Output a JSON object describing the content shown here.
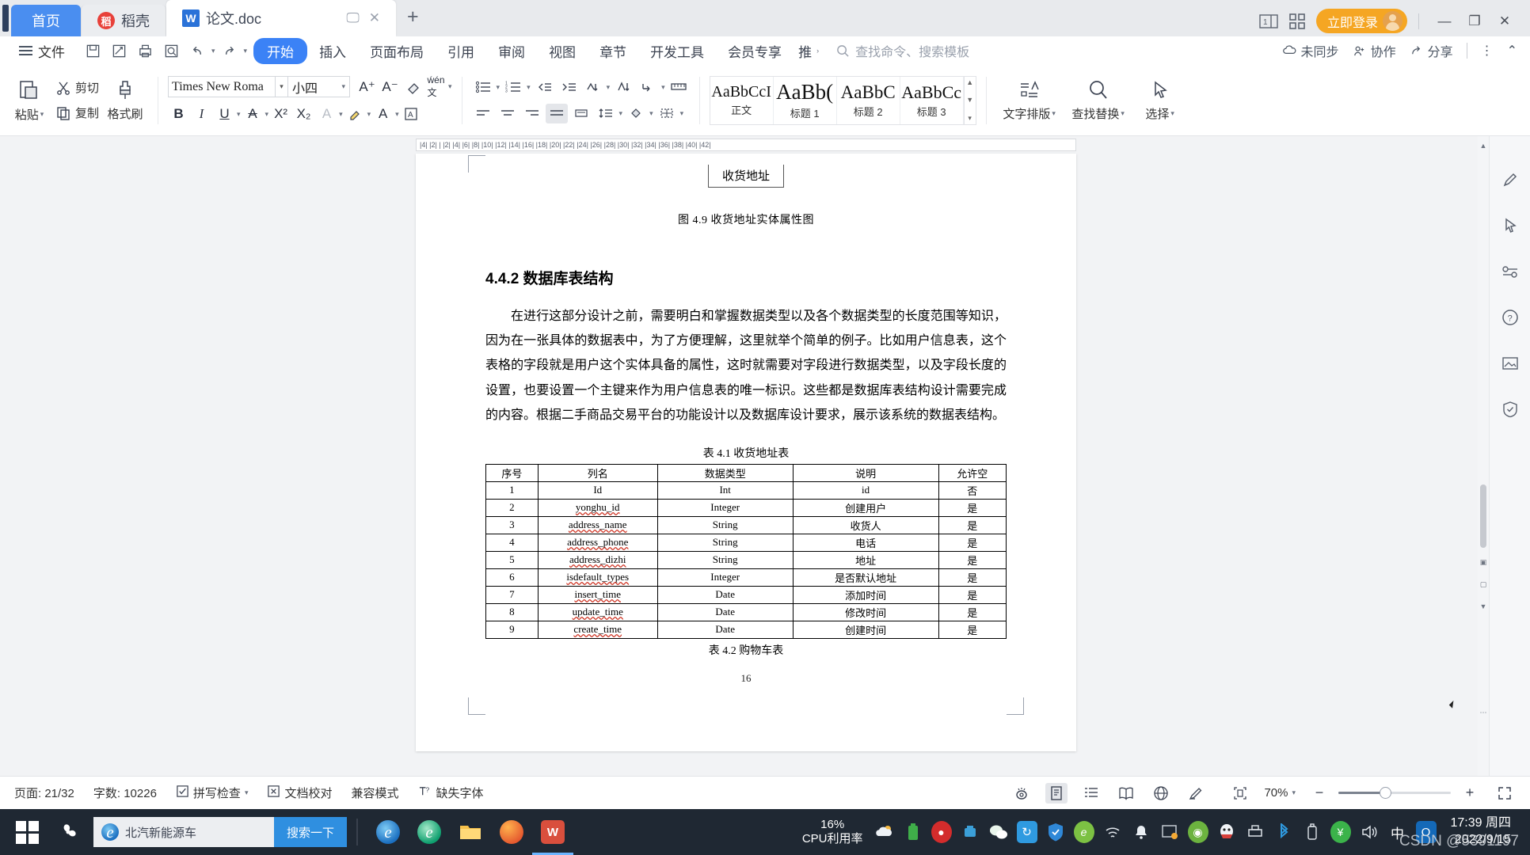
{
  "window": {
    "tabs": [
      {
        "label": "首页",
        "icon": "home-icon",
        "state": "home"
      },
      {
        "label": "稻壳",
        "icon": "docer-icon",
        "state": "inactive"
      },
      {
        "label": "论文.doc",
        "icon": "wps-writer-icon",
        "state": "active"
      }
    ],
    "tab_actions": {
      "cast_icon": "cast-icon",
      "close_icon": "close-icon",
      "new_tab": "+"
    },
    "right_icons": {
      "sidebar_icon": "page-toggle-icon",
      "apps_icon": "app-grid-icon"
    },
    "login_label": "立即登录",
    "controls": {
      "minimize": "—",
      "maximize": "❐",
      "close": "✕"
    }
  },
  "menubar": {
    "file_label": "文件",
    "quick_access": [
      "save-icon",
      "save-as-icon",
      "print-icon",
      "print-preview-icon",
      "undo-icon",
      "redo-icon",
      "qat-more-icon"
    ],
    "tabs": [
      {
        "label": "开始",
        "active": true
      },
      {
        "label": "插入",
        "active": false
      },
      {
        "label": "页面布局",
        "active": false
      },
      {
        "label": "引用",
        "active": false
      },
      {
        "label": "审阅",
        "active": false
      },
      {
        "label": "视图",
        "active": false
      },
      {
        "label": "章节",
        "active": false
      },
      {
        "label": "开发工具",
        "active": false
      },
      {
        "label": "会员专享",
        "active": false
      },
      {
        "label": "推",
        "active": false
      }
    ],
    "search_placeholder": "查找命令、搜索模板",
    "right": [
      {
        "label": "未同步",
        "icon": "cloud-sync-icon"
      },
      {
        "label": "协作",
        "icon": "collaborate-icon"
      },
      {
        "label": "分享",
        "icon": "share-icon"
      }
    ],
    "more_icon": "more-vertical-icon",
    "collapse_icon": "chevron-up-icon"
  },
  "ribbon": {
    "clipboard": {
      "paste_label": "粘贴",
      "cut_label": "剪切",
      "copy_label": "复制",
      "format_painter_label": "格式刷"
    },
    "font": {
      "name": "Times New Roma",
      "size": "小四",
      "grow_icon": "increase-font-size-icon",
      "shrink_icon": "decrease-font-size-icon",
      "clear_format_icon": "clear-formatting-icon",
      "pinyin_icon": "pinyin-guide-icon",
      "bold": "B",
      "italic": "I",
      "underline": "U",
      "strikethrough": "A",
      "superscript": "X²",
      "subscript": "X₂",
      "text_effect_icon": "text-effects-icon",
      "highlight_icon": "highlight-color-icon",
      "font_color_icon": "font-color-icon",
      "char_border_icon": "character-border-icon"
    },
    "paragraph": {
      "bullets_icon": "bullet-list-icon",
      "numbering_icon": "numbered-list-icon",
      "decrease_indent_icon": "decrease-indent-icon",
      "increase_indent_icon": "increase-indent-icon",
      "sort_icon": "sort-icon",
      "pinyin_sort_icon": "paragraph-sort-icon",
      "show_marks_icon": "show-formatting-marks-icon",
      "ruler_icon": "document-grid-icon",
      "align_left_icon": "align-left-icon",
      "align_center_icon": "align-center-icon",
      "align_right_icon": "align-right-icon",
      "justify_icon": "justify-icon",
      "distribute_icon": "distribute-icon",
      "line_spacing_icon": "line-spacing-icon",
      "shading_icon": "shading-icon",
      "borders_icon": "borders-icon"
    },
    "styles": [
      {
        "preview": "AaBbCcI",
        "name": "正文"
      },
      {
        "preview": "AaBb(",
        "name": "标题 1"
      },
      {
        "preview": "AaBbC",
        "name": "标题 2"
      },
      {
        "preview": "AaBbCc",
        "name": "标题 3"
      }
    ],
    "typeset_label": "文字排版",
    "find_replace_label": "查找替换",
    "select_label": "选择"
  },
  "ruler": {
    "left_marks": "4  2",
    "ticks": "|4| |2| | |2| |4| |6| |8| |10| |12| |14| |16| |18| |20| |22| |24| |26| |28| |30| |32| |34| |36| |38| |40| |42|"
  },
  "document": {
    "figure_box_label": "收货地址",
    "figure_caption": "图 4.9 收货地址实体属性图",
    "section_heading": "4.4.2 数据库表结构",
    "paragraph": "在进行这部分设计之前，需要明白和掌握数据类型以及各个数据类型的长度范围等知识，因为在一张具体的数据表中，为了方便理解，这里就举个简单的例子。比如用户信息表，这个表格的字段就是用户这个实体具备的属性，这时就需要对字段进行数据类型，以及字段长度的设置，也要设置一个主键来作为用户信息表的唯一标识。这些都是数据库表结构设计需要完成的内容。根据二手商品交易平台的功能设计以及数据库设计要求，展示该系统的数据表结构。",
    "table_caption": "表 4.1 收货地址表",
    "table_headers": [
      "序号",
      "列名",
      "数据类型",
      "说明",
      "允许空"
    ],
    "table_rows": [
      [
        "1",
        "Id",
        "Int",
        "id",
        "否"
      ],
      [
        "2",
        "yonghu_id",
        "Integer",
        "创建用户",
        "是"
      ],
      [
        "3",
        "address_name",
        "String",
        "收货人",
        "是"
      ],
      [
        "4",
        "address_phone",
        "String",
        "电话",
        "是"
      ],
      [
        "5",
        "address_dizhi",
        "String",
        "地址",
        "是"
      ],
      [
        "6",
        "isdefault_types",
        "Integer",
        "是否默认地址",
        "是"
      ],
      [
        "7",
        "insert_time",
        "Date",
        "添加时间",
        "是"
      ],
      [
        "8",
        "update_time",
        "Date",
        "修改时间",
        "是"
      ],
      [
        "9",
        "create_time",
        "Date",
        "创建时间",
        "是"
      ]
    ],
    "next_table_caption": "表 4.2 购物车表",
    "page_number": "16"
  },
  "rail_icons": [
    "pen-tool-icon",
    "cursor-select-icon",
    "shapes-icon",
    "help-icon",
    "image-tool-icon",
    "shield-icon"
  ],
  "statusbar": {
    "page_label": "页面: 21/32",
    "word_count_label": "字数: 10226",
    "spellcheck_label": "拼写检查",
    "proofread_label": "文档校对",
    "compat_label": "兼容模式",
    "missing_font_label": "缺失字体",
    "view_icons": [
      "eye-protect-icon",
      "print-layout-icon",
      "outline-view-icon",
      "reading-view-icon",
      "web-layout-icon",
      "pen-mark-icon",
      "fit-page-icon"
    ],
    "zoom_level": "70%",
    "zoom_out": "−",
    "zoom_in": "+",
    "fullscreen_icon": "fullscreen-icon"
  },
  "taskbar": {
    "start_icon": "windows-start-icon",
    "fan_icon": "fan-app-icon",
    "search_value": "北汽新能源车",
    "search_button": "搜索一下",
    "pinned": [
      "ie-browser-icon",
      "edge-browser-icon",
      "file-explorer-icon",
      "firefox-icon",
      "wps-writer-icon"
    ],
    "cpu_percent": "16%",
    "cpu_label": "CPU利用率",
    "tray_icons": [
      "weather-icon",
      "battery-app-icon",
      "ninja-icon",
      "usb-icon",
      "wechat-icon",
      "sync-icon",
      "security-shield-icon",
      "360-browser-icon",
      "wifi-icon",
      "notification-bell-icon",
      "update-icon",
      "app-green-icon",
      "qq-icon",
      "printer-icon",
      "bluetooth-icon",
      "usb-drive-icon",
      "money-icon",
      "volume-icon",
      "ime-chinese-icon",
      "outlook-icon"
    ],
    "ime_label": "中",
    "clock_time": "17:39 周四",
    "clock_date": "2022/9/15",
    "watermark": "CSDN @5391197"
  }
}
